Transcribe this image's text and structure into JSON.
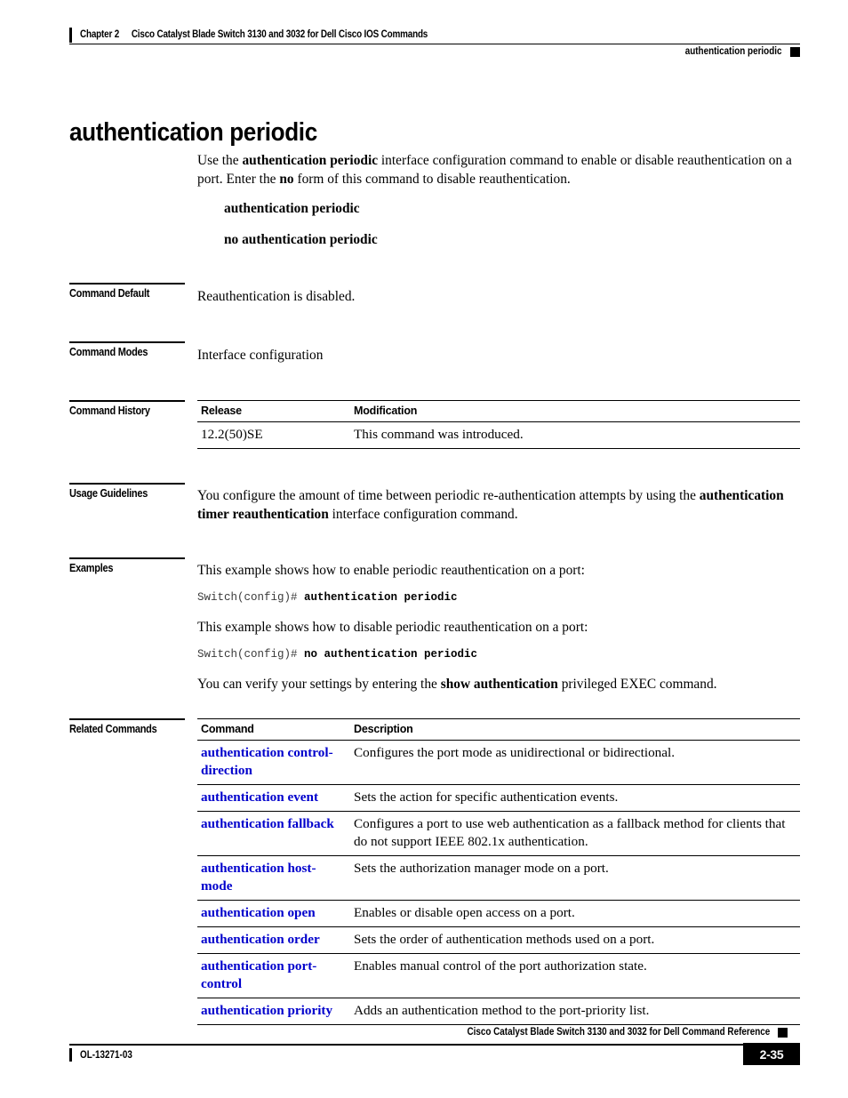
{
  "header": {
    "chapter": "Chapter 2",
    "chapter_title": "Cisco Catalyst Blade Switch 3130 and 3032 for Dell Cisco IOS Commands",
    "topic": "authentication periodic"
  },
  "title": "authentication periodic",
  "intro": {
    "part1": "Use the ",
    "bold1": "authentication periodic",
    "part2": " interface configuration command to enable or disable reauthentication on a port. Enter the ",
    "bold2": "no",
    "part3": " form of this command to disable reauthentication."
  },
  "syntax": {
    "positive": "authentication periodic",
    "negative": "no authentication periodic"
  },
  "sections": {
    "command_default": {
      "label": "Command Default",
      "text": "Reauthentication is disabled."
    },
    "command_modes": {
      "label": "Command Modes",
      "text": "Interface configuration"
    },
    "command_history": {
      "label": "Command History",
      "columns": [
        "Release",
        "Modification"
      ],
      "rows": [
        [
          "12.2(50)SE",
          "This command was introduced."
        ]
      ]
    },
    "usage_guidelines": {
      "label": "Usage Guidelines",
      "part1": "You configure the amount of time between periodic re-authentication attempts by using the ",
      "bold1": "authentication timer reauthentication",
      "part2": " interface configuration command."
    },
    "examples": {
      "label": "Examples",
      "intro1": "This example shows how to enable periodic reauthentication on a port:",
      "prompt1": "Switch(config)# ",
      "command1": "authentication periodic",
      "intro2": "This example shows how to disable periodic reauthentication on a port:",
      "prompt2": "Switch(config)# ",
      "command2": "no authentication periodic",
      "verify_part1": "You can verify your settings by entering the ",
      "verify_bold": "show authentication",
      "verify_part2": " privileged EXEC command."
    },
    "related_commands": {
      "label": "Related Commands",
      "columns": [
        "Command",
        "Description"
      ],
      "rows": [
        [
          "authentication control-direction",
          "Configures the port mode as unidirectional or bidirectional."
        ],
        [
          "authentication event",
          "Sets the action for specific authentication events."
        ],
        [
          "authentication fallback",
          "Configures a port to use web authentication as a fallback method for clients that do not support IEEE 802.1x authentication."
        ],
        [
          "authentication host-mode",
          "Sets the authorization manager mode on a port."
        ],
        [
          "authentication open",
          "Enables or disable open access on a port."
        ],
        [
          "authentication order",
          "Sets the order of authentication methods used on a port."
        ],
        [
          "authentication port-control",
          "Enables manual control of the port authorization state."
        ],
        [
          "authentication priority",
          "Adds an authentication method to the port-priority list."
        ]
      ]
    }
  },
  "footer": {
    "doc_id": "OL-13271-03",
    "doc_title": "Cisco Catalyst Blade Switch 3130 and 3032 for Dell Command Reference",
    "page_number": "2-35"
  },
  "colors": {
    "link_blue": "#0000cc",
    "text_black": "#000000"
  }
}
